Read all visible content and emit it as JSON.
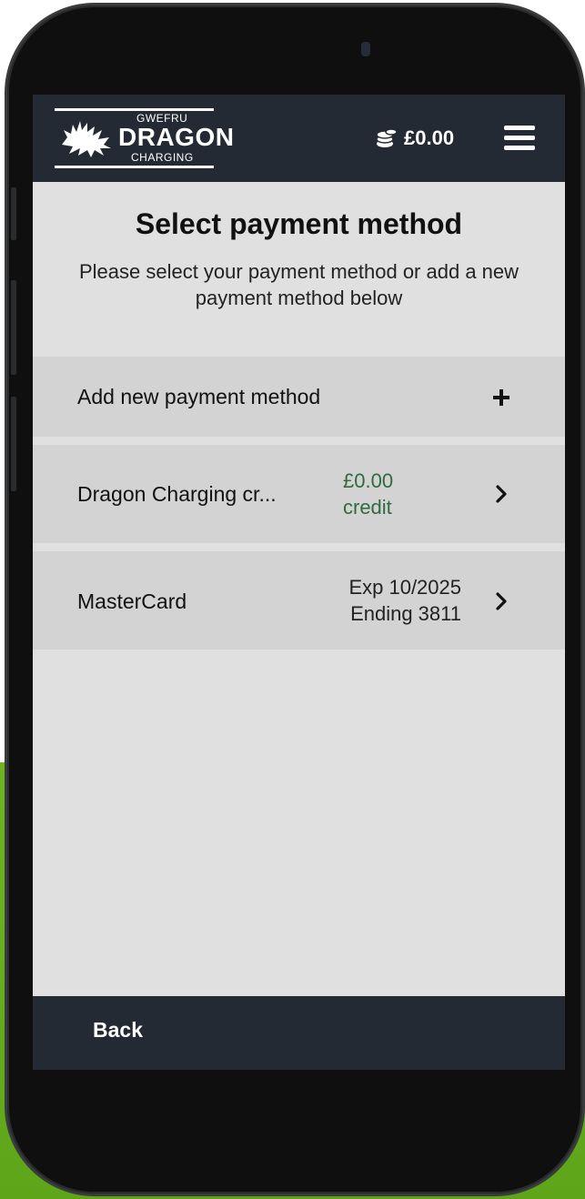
{
  "header": {
    "logo_top_text": "GWEFRU",
    "logo_brand": "DRAGON",
    "logo_bottom_text": "CHARGING",
    "balance": "£0.00",
    "balance_icon": "coins-icon",
    "menu_icon": "hamburger-menu-icon"
  },
  "main": {
    "title": "Select payment method",
    "subtitle": "Please select your payment method or add a new payment method below"
  },
  "payment_methods": {
    "add": {
      "label": "Add new payment method",
      "icon": "plus-icon"
    },
    "items": [
      {
        "label": "Dragon Charging cr...",
        "meta_line1": "£0.00",
        "meta_line2": "credit",
        "icon": "chevron-right-icon"
      },
      {
        "label": "MasterCard",
        "meta_line1": "Exp 10/2025",
        "meta_line2": "Ending 3811",
        "icon": "chevron-right-icon"
      }
    ]
  },
  "footer": {
    "back_label": "Back"
  },
  "colors": {
    "header_bg": "#242a33",
    "screen_bg": "#e0e0e0",
    "row_bg": "#d3d3d3",
    "credit_text": "#2f6b3f",
    "outer_accent": "#6fb520"
  }
}
